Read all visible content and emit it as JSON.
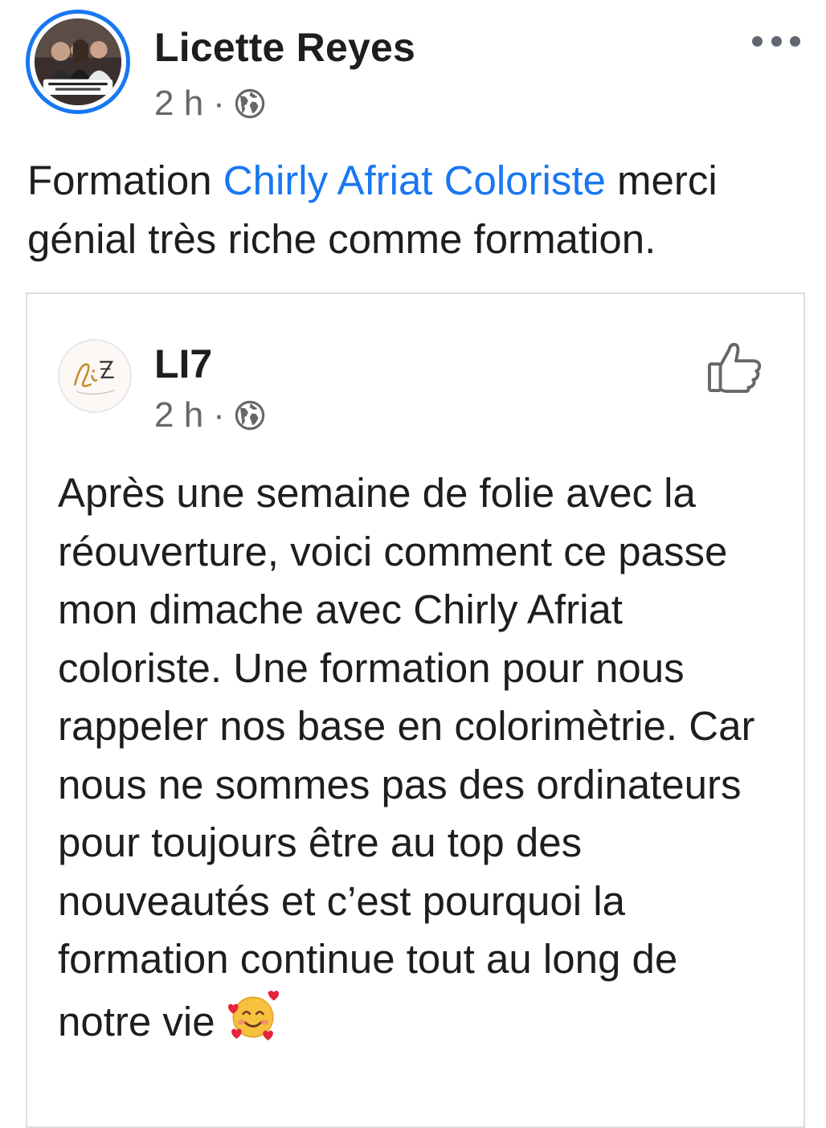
{
  "post": {
    "author": "Licette Reyes",
    "time": "2 h",
    "separator": "·",
    "text_before": "Formation ",
    "mention": "Chirly Afriat Coloriste",
    "text_after": " merci génial très riche comme formation."
  },
  "shared": {
    "page_name": "LI7",
    "time": "2 h",
    "separator": "·",
    "text": "Après une semaine de folie avec la réouverture, voici comment ce passe mon dimache avec Chirly Afriat coloriste. Une formation pour nous rappeler nos base en colorimètrie. Car nous ne sommes pas des ordinateurs pour toujours être au top des nouveautés et c’est pourquoi la formation continue tout au long de notre vie"
  },
  "icons": {
    "more": "more-horizontal-icon",
    "privacy": "globe-icon",
    "like": "thumbs-up-icon",
    "emoji": "smiling-face-with-hearts-emoji"
  },
  "colors": {
    "accent": "#1877f2",
    "text": "#1c1e21",
    "secondary": "#65676b",
    "border": "#dadde1"
  }
}
